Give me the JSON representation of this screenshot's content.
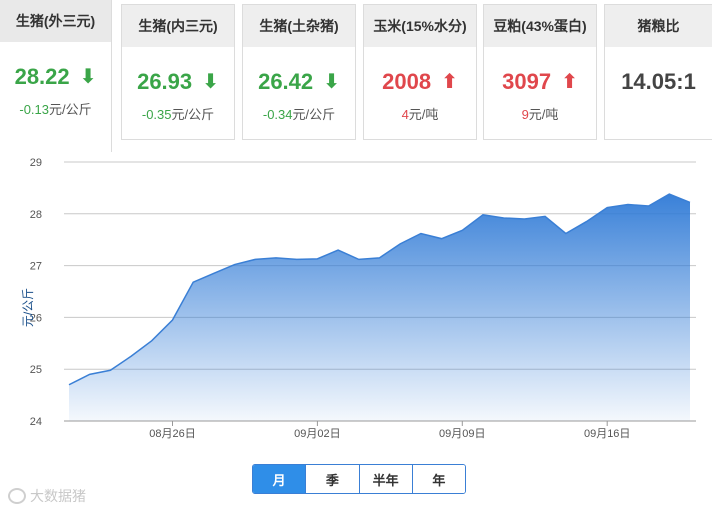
{
  "cards": [
    {
      "title": "生猪(外三元)",
      "value": "28.22",
      "arrow": "down",
      "change": "-0.13",
      "unit": "元/公斤"
    },
    {
      "title": "生猪(内三元)",
      "value": "26.93",
      "arrow": "down",
      "change": "-0.35",
      "unit": "元/公斤"
    },
    {
      "title": "生猪(土杂猪)",
      "value": "26.42",
      "arrow": "down",
      "change": "-0.34",
      "unit": "元/公斤"
    },
    {
      "title": "玉米(15%水分)",
      "value": "2008",
      "arrow": "up",
      "change": "4",
      "unit": "元/吨"
    },
    {
      "title": "豆粕(43%蛋白)",
      "value": "3097",
      "arrow": "up",
      "change": "9",
      "unit": "元/吨"
    },
    {
      "title": "猪粮比",
      "value": "14.05:1",
      "arrow": "",
      "change": "",
      "unit": ""
    }
  ],
  "colors": {
    "down": "#3aa548",
    "up": "#e0474c",
    "line": "#3a7fd5",
    "button_active": "#2f8ee8"
  },
  "range_buttons": [
    {
      "label": "月",
      "selected": true
    },
    {
      "label": "季",
      "selected": false
    },
    {
      "label": "半年",
      "selected": false
    },
    {
      "label": "年",
      "selected": false
    }
  ],
  "watermark": "大数据猪",
  "chart_data": {
    "type": "area",
    "ylabel": "元/公斤",
    "ylim": [
      24,
      29
    ],
    "yticks": [
      24,
      25,
      26,
      27,
      28,
      29
    ],
    "xticks": [
      "08月26日",
      "09月02日",
      "09月09日",
      "09月16日"
    ],
    "grid": true,
    "x": [
      "08-21",
      "08-22",
      "08-23",
      "08-24",
      "08-25",
      "08-26",
      "08-27",
      "08-28",
      "08-29",
      "08-30",
      "08-31",
      "09-01",
      "09-02",
      "09-03",
      "09-04",
      "09-05",
      "09-06",
      "09-07",
      "09-08",
      "09-09",
      "09-10",
      "09-11",
      "09-12",
      "09-13",
      "09-14",
      "09-15",
      "09-16",
      "09-17",
      "09-18",
      "09-19",
      "09-20",
      "09-21"
    ],
    "series": [
      {
        "values": [
          24.7,
          24.9,
          24.98,
          25.25,
          25.55,
          25.95,
          26.68,
          26.85,
          27.02,
          27.12,
          27.15,
          27.12,
          27.13,
          27.3,
          27.12,
          27.15,
          27.42,
          27.62,
          27.52,
          27.68,
          27.98,
          27.92,
          27.9,
          27.95,
          27.62,
          27.85,
          28.12,
          28.18,
          28.15,
          28.38,
          28.22
        ]
      }
    ]
  }
}
